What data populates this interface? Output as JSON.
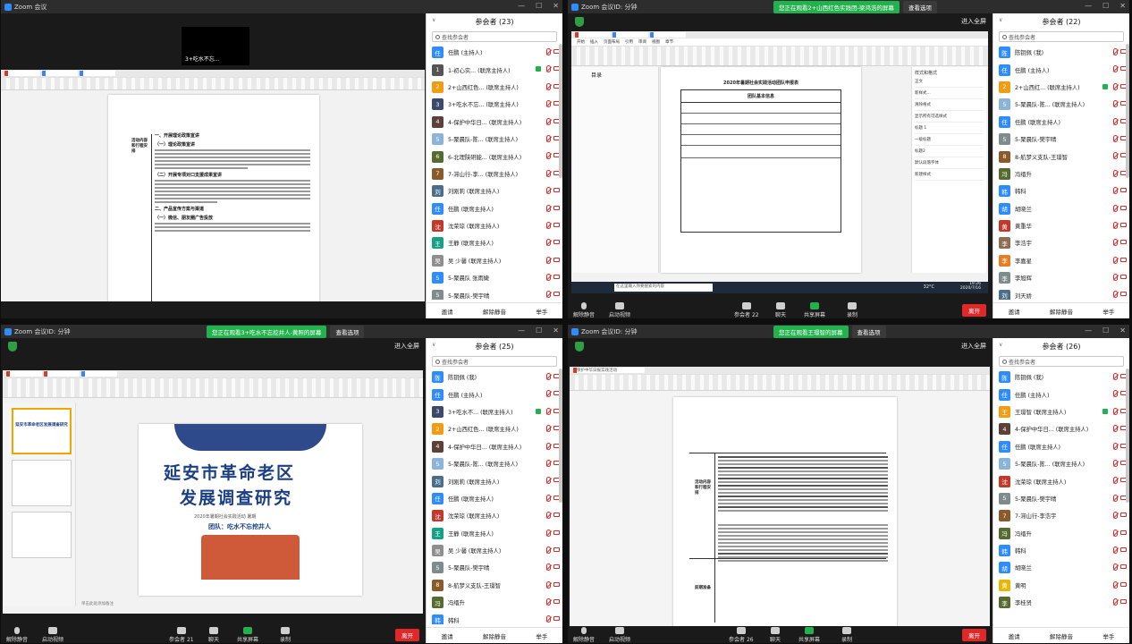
{
  "q1": {
    "window_title": "Zoom 会议",
    "tile_name": "3+吃水不忘...",
    "page": {
      "table_label": "活动内容和行程安排",
      "h1": "一、开展理论政策宣讲",
      "h2": "（一）理论政策宣讲",
      "h3": "（二）开展专项对口支援成果宣讲",
      "h4": "二、产品宣传方案与渠道",
      "h5": "（一）微信、朋友圈广告投放"
    },
    "panel": {
      "title": "参会者 (23)",
      "search": "查找参会者",
      "rows": [
        {
          "name": "任鹏 (主持人)",
          "avatar": "任",
          "color": "#2d8cff",
          "cam": false
        },
        {
          "name": "1-初心实... (联席主持人)",
          "avatar": "1",
          "color": "#555",
          "cam": true
        },
        {
          "name": "2+山西红色... (联席主持人)",
          "avatar": "2",
          "color": "#f39c12",
          "cam": false
        },
        {
          "name": "3+吃水不忘... (联席主持人)",
          "avatar": "3",
          "color": "#3b4a6b",
          "cam": false
        },
        {
          "name": "4-保护中华日... (联席主持人)",
          "avatar": "4",
          "color": "#5d4037",
          "cam": false
        },
        {
          "name": "5-聚晨队-陈... (联席主持人)",
          "avatar": "5",
          "color": "#8ab4d8",
          "cam": false
        },
        {
          "name": "6-北理陕研能... (联席主持人)",
          "avatar": "6",
          "color": "#556b2f",
          "cam": false
        },
        {
          "name": "7-滞山行-李... (联席主持人)",
          "avatar": "7",
          "color": "#8b5a2b",
          "cam": false
        },
        {
          "name": "刘刚莉 (联席主持人)",
          "avatar": "刘",
          "color": "#4a6d8c",
          "cam": false
        },
        {
          "name": "任鹏 (联席主持人)",
          "avatar": "任",
          "color": "#2d8cff",
          "cam": false
        },
        {
          "name": "沈荣琼 (联席主持人)",
          "avatar": "沈",
          "color": "#c0392b",
          "cam": false
        },
        {
          "name": "王静 (联席主持人)",
          "avatar": "王",
          "color": "#16a085",
          "cam": false
        },
        {
          "name": "吴 少馨 (联席主持人)",
          "avatar": "吴",
          "color": "#8e8e8e",
          "cam": false
        },
        {
          "name": "5-聚晨队 张雨婕",
          "avatar": "5",
          "color": "#2d8cff",
          "cam": false
        },
        {
          "name": "5-聚晨队-樊宇晴",
          "avatar": "5",
          "color": "#7f8c8d",
          "cam": false
        }
      ],
      "invite": "邀请",
      "unmute_all": "解除静音",
      "raise_hand": "举手"
    }
  },
  "q2": {
    "window_title": "Zoom 会议ID: 分钟",
    "banner": "您正在观看2+山西红色实践团-梁鸿浩的屏幕",
    "view_options": "查看选项",
    "fullscreen": "进入全屏",
    "doc_title": "2020年暑期社会实践活动团队申报表",
    "doc_subtitle": "团队基本信息",
    "toc_label": "目录",
    "style_panel_title": "样式和格式",
    "style_items": [
      "正文",
      "新样式...",
      "清除格式",
      "显示所有可选样式",
      "标题 1",
      "一级标题",
      "标题2",
      "默认段落字体",
      "新建样式"
    ],
    "time": "19:26",
    "date": "2020/7/16",
    "temp": "32°C",
    "search_box": "在这里输入你要搜索的内容",
    "controls": {
      "unmute": "解除静音",
      "video": "启动视频",
      "participants": "参会者",
      "participant_count": "22",
      "chat": "聊天",
      "share": "共享屏幕",
      "record": "录制",
      "leave": "离开"
    },
    "panel": {
      "title": "参会者 (22)",
      "search": "查找参会者",
      "rows": [
        {
          "name": "陈钥佩 (我)",
          "avatar": "陈",
          "color": "#2d8cff",
          "cam": false
        },
        {
          "name": "任鹏 (主持人)",
          "avatar": "任",
          "color": "#2d8cff",
          "cam": false
        },
        {
          "name": "2+山西红... (联席主持人)",
          "avatar": "2",
          "color": "#f39c12",
          "cam": true
        },
        {
          "name": "5-聚晨队-陈... (联席主持人)",
          "avatar": "5",
          "color": "#8ab4d8",
          "cam": false
        },
        {
          "name": "任鹏 (联席主持人)",
          "avatar": "任",
          "color": "#2d8cff",
          "cam": false
        },
        {
          "name": "5-聚晨队-樊宇晴",
          "avatar": "5",
          "color": "#7f8c8d",
          "cam": false
        },
        {
          "name": "8-航梦义支队-王璟智",
          "avatar": "8",
          "color": "#8b5a2b",
          "cam": false
        },
        {
          "name": "冯缙升",
          "avatar": "冯",
          "color": "#556b2f",
          "cam": false
        },
        {
          "name": "韩科",
          "avatar": "韩",
          "color": "#2d8cff",
          "cam": false
        },
        {
          "name": "胡晓兰",
          "avatar": "胡",
          "color": "#2d8cff",
          "cam": false
        },
        {
          "name": "黄重华",
          "avatar": "黄",
          "color": "#c0392b",
          "cam": false
        },
        {
          "name": "李浩宇",
          "avatar": "李",
          "color": "#8e6e53",
          "cam": false
        },
        {
          "name": "李嘉星",
          "avatar": "李",
          "color": "#e67e22",
          "cam": false
        },
        {
          "name": "李旭辉",
          "avatar": "李",
          "color": "#7f8c8d",
          "cam": false
        },
        {
          "name": "刘天娇",
          "avatar": "刘",
          "color": "#4a6d8c",
          "cam": false
        }
      ],
      "invite": "邀请",
      "unmute_all": "解除静音",
      "raise_hand": "举手"
    }
  },
  "q3": {
    "window_title": "Zoom 会议ID: 分钟",
    "banner": "您正在观看3+吃水不忘挖井人-黄照的屏幕",
    "view_options": "查看选项",
    "fullscreen": "进入全屏",
    "slide_title_1": "延安市革命老区",
    "slide_title_2": "发展调查研究",
    "slide_subtitle": "2020年暑期社会实践活动 暑期",
    "slide_team": "团队：吃水不忘挖井人",
    "thumb_title": "延安市革命老区发展调查研究",
    "slide_notes": "单击此处添加备注",
    "controls": {
      "unmute": "解除静音",
      "video": "启动视频",
      "participants": "参会者",
      "participant_count": "21",
      "chat": "聊天",
      "share": "共享屏幕",
      "record": "录制",
      "leave": "离开"
    },
    "panel": {
      "title": "参会者 (25)",
      "search": "查找参会者",
      "rows": [
        {
          "name": "陈钥佩 (我)",
          "avatar": "陈",
          "color": "#2d8cff",
          "cam": false
        },
        {
          "name": "任鹏 (主持人)",
          "avatar": "任",
          "color": "#2d8cff",
          "cam": false
        },
        {
          "name": "3+吃水不... (联席主持人)",
          "avatar": "3",
          "color": "#3b4a6b",
          "cam": true
        },
        {
          "name": "2+山西红色... (联席主持人)",
          "avatar": "2",
          "color": "#f39c12",
          "cam": false
        },
        {
          "name": "4-保护中华日... (联席主持人)",
          "avatar": "4",
          "color": "#5d4037",
          "cam": false
        },
        {
          "name": "5-聚晨队-陈... (联席主持人)",
          "avatar": "5",
          "color": "#8ab4d8",
          "cam": false
        },
        {
          "name": "刘刚莉 (联席主持人)",
          "avatar": "刘",
          "color": "#4a6d8c",
          "cam": false
        },
        {
          "name": "任鹏 (联席主持人)",
          "avatar": "任",
          "color": "#2d8cff",
          "cam": false
        },
        {
          "name": "沈荣琼 (联席主持人)",
          "avatar": "沈",
          "color": "#c0392b",
          "cam": false
        },
        {
          "name": "王静 (联席主持人)",
          "avatar": "王",
          "color": "#16a085",
          "cam": false
        },
        {
          "name": "吴 少馨 (联席主持人)",
          "avatar": "吴",
          "color": "#8e8e8e",
          "cam": false
        },
        {
          "name": "5-聚晨队-樊宇晴",
          "avatar": "5",
          "color": "#7f8c8d",
          "cam": false
        },
        {
          "name": "8-航梦义支队-王璟智",
          "avatar": "8",
          "color": "#8b5a2b",
          "cam": false
        },
        {
          "name": "冯缙升",
          "avatar": "冯",
          "color": "#556b2f",
          "cam": false
        },
        {
          "name": "韩科",
          "avatar": "韩",
          "color": "#2d8cff",
          "cam": false
        }
      ],
      "invite": "邀请",
      "unmute_all": "解除静音",
      "raise_hand": "举手"
    }
  },
  "q4": {
    "window_title": "Zoom 会议ID: 分钟",
    "banner": "您正在观看王璟智的屏幕",
    "view_options": "查看选项",
    "fullscreen": "进入全屏",
    "tab_label": "保护中华日报实践活动",
    "row_label_1": "活动内容和行程安排",
    "row_label_2": "前期准备",
    "controls": {
      "unmute": "解除静音",
      "video": "启动视频",
      "participants": "参会者",
      "participant_count": "26",
      "chat": "聊天",
      "share": "共享屏幕",
      "record": "录制",
      "leave": "离开"
    },
    "panel": {
      "title": "参会者 (26)",
      "search": "查找参会者",
      "rows": [
        {
          "name": "陈钥佩 (我)",
          "avatar": "陈",
          "color": "#2d8cff",
          "cam": false
        },
        {
          "name": "任鹏 (主持人)",
          "avatar": "任",
          "color": "#2d8cff",
          "cam": false
        },
        {
          "name": "王璟智 (联席主持人)",
          "avatar": "王",
          "color": "#f39c12",
          "cam": true
        },
        {
          "name": "4-保护中华日... (联席主持人)",
          "avatar": "4",
          "color": "#5d4037",
          "cam": false
        },
        {
          "name": "任鹏 (联席主持人)",
          "avatar": "任",
          "color": "#2d8cff",
          "cam": false
        },
        {
          "name": "5-聚晨队-陈... (联席主持人)",
          "avatar": "5",
          "color": "#8ab4d8",
          "cam": false
        },
        {
          "name": "沈荣琼 (联席主持人)",
          "avatar": "沈",
          "color": "#c0392b",
          "cam": false
        },
        {
          "name": "5-聚晨队-樊宇晴",
          "avatar": "5",
          "color": "#7f8c8d",
          "cam": false
        },
        {
          "name": "7-滞山行-李浩宇",
          "avatar": "7",
          "color": "#8b5a2b",
          "cam": false
        },
        {
          "name": "冯缙升",
          "avatar": "冯",
          "color": "#556b2f",
          "cam": false
        },
        {
          "name": "韩科",
          "avatar": "韩",
          "color": "#2d8cff",
          "cam": false
        },
        {
          "name": "胡晓兰",
          "avatar": "胡",
          "color": "#2d8cff",
          "cam": false
        },
        {
          "name": "黄明",
          "avatar": "黄",
          "color": "#e6b800",
          "cam": false
        },
        {
          "name": "李桂贤",
          "avatar": "李",
          "color": "#556b2f",
          "cam": false
        }
      ],
      "invite": "邀请",
      "unmute_all": "解除静音",
      "raise_hand": "举手"
    }
  }
}
